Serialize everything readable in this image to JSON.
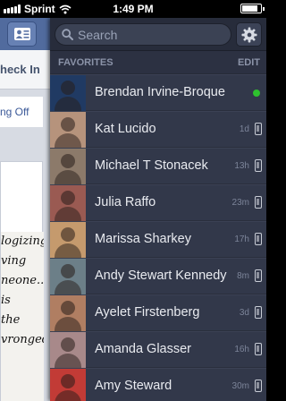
{
  "status_bar": {
    "carrier": "Sprint",
    "time": "1:49 PM",
    "battery_level": 0.85
  },
  "feed": {
    "checkin_label": "heck In",
    "card_text": "ng Off",
    "post_lines": [
      "logizing",
      "ving",
      "neone...",
      "is",
      "the",
      "vronged"
    ]
  },
  "search": {
    "placeholder": "Search"
  },
  "favorites": {
    "title": "FAVORITES",
    "edit_label": "EDIT",
    "contacts": [
      {
        "name": "Brendan Irvine-Broque",
        "time": "",
        "status": "online",
        "avatar_color": "#203a63"
      },
      {
        "name": "Kat Lucido",
        "time": "1d",
        "status": "mobile",
        "avatar_color": "#b6937c"
      },
      {
        "name": "Michael T Stonacek",
        "time": "13h",
        "status": "mobile",
        "avatar_color": "#8c7a6a"
      },
      {
        "name": "Julia Raffo",
        "time": "23m",
        "status": "mobile",
        "avatar_color": "#9a5a52"
      },
      {
        "name": "Marissa Sharkey",
        "time": "17h",
        "status": "mobile",
        "avatar_color": "#c59a6d"
      },
      {
        "name": "Andy Stewart Kennedy",
        "time": "8m",
        "status": "mobile",
        "avatar_color": "#6c7f88"
      },
      {
        "name": "Ayelet Firstenberg",
        "time": "3d",
        "status": "mobile",
        "avatar_color": "#b07e62"
      },
      {
        "name": "Amanda Glasser",
        "time": "16h",
        "status": "mobile",
        "avatar_color": "#a8898a"
      },
      {
        "name": "Amy Steward",
        "time": "30m",
        "status": "mobile",
        "avatar_color": "#c23b36"
      }
    ]
  }
}
